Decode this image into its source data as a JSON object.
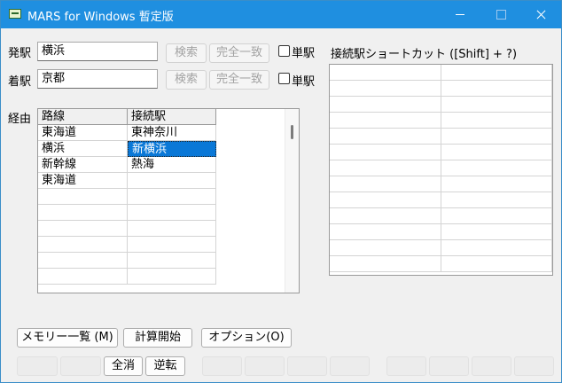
{
  "window": {
    "title": "MARS for Windows 暫定版"
  },
  "departure": {
    "label": "発駅",
    "value": "横浜",
    "search_label": "検索",
    "exact_label": "完全一致",
    "single_label": "単駅",
    "single_checked": false
  },
  "arrival": {
    "label": "着駅",
    "value": "京都",
    "search_label": "検索",
    "exact_label": "完全一致",
    "single_label": "単駅",
    "single_checked": false
  },
  "route": {
    "label": "経由",
    "columns": [
      "路線",
      "接続駅"
    ],
    "rows": [
      [
        "東海道",
        "東神奈川"
      ],
      [
        "横浜",
        "新横浜"
      ],
      [
        "新幹線",
        "熱海"
      ],
      [
        "東海道",
        ""
      ],
      [
        "",
        ""
      ],
      [
        "",
        ""
      ],
      [
        "",
        ""
      ],
      [
        "",
        ""
      ],
      [
        "",
        ""
      ],
      [
        "",
        ""
      ]
    ],
    "selected": [
      1,
      1
    ]
  },
  "shortcut": {
    "label": "接続駅ショートカット ([Shift] + ?)"
  },
  "actions": {
    "memory_list": "メモリー一覧 (M)",
    "calc_start": "計算開始",
    "options": "オプション(O)",
    "clear_all": "全消",
    "reverse": "逆転"
  }
}
